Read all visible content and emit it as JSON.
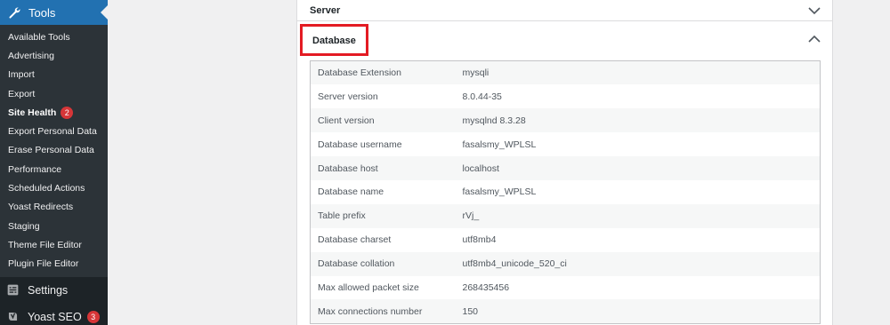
{
  "sidebar": {
    "tools_label": "Tools",
    "submenu": [
      {
        "label": "Available Tools"
      },
      {
        "label": "Advertising"
      },
      {
        "label": "Import"
      },
      {
        "label": "Export"
      },
      {
        "label": "Site Health",
        "badge": "2",
        "current": true
      },
      {
        "label": "Export Personal Data"
      },
      {
        "label": "Erase Personal Data"
      },
      {
        "label": "Performance"
      },
      {
        "label": "Scheduled Actions"
      },
      {
        "label": "Yoast Redirects"
      },
      {
        "label": "Staging"
      },
      {
        "label": "Theme File Editor"
      },
      {
        "label": "Plugin File Editor"
      }
    ],
    "settings_label": "Settings",
    "yoast_label": "Yoast SEO",
    "yoast_badge": "3"
  },
  "sections": {
    "server_title": "Server",
    "database_title": "Database"
  },
  "database_rows": [
    {
      "key": "Database Extension",
      "value": "mysqli"
    },
    {
      "key": "Server version",
      "value": "8.0.44-35"
    },
    {
      "key": "Client version",
      "value": "mysqlnd 8.3.28"
    },
    {
      "key": "Database username",
      "value": "fasalsmy_WPLSL"
    },
    {
      "key": "Database host",
      "value": "localhost"
    },
    {
      "key": "Database name",
      "value": "fasalsmy_WPLSL"
    },
    {
      "key": "Table prefix",
      "value": "rVj_"
    },
    {
      "key": "Database charset",
      "value": "utf8mb4"
    },
    {
      "key": "Database collation",
      "value": "utf8mb4_unicode_520_ci"
    },
    {
      "key": "Max allowed packet size",
      "value": "268435456"
    },
    {
      "key": "Max connections number",
      "value": "150"
    }
  ],
  "colors": {
    "sidebar_bg": "#1d2327",
    "submenu_bg": "#2c3338",
    "accent": "#2271b1",
    "badge": "#d63638",
    "highlight_box": "#e31b23"
  },
  "icons": {
    "tools": "wrench-icon",
    "settings": "settings-icon",
    "yoast": "yoast-icon",
    "collapsed": "chevron-down-icon",
    "expanded": "chevron-up-icon"
  }
}
